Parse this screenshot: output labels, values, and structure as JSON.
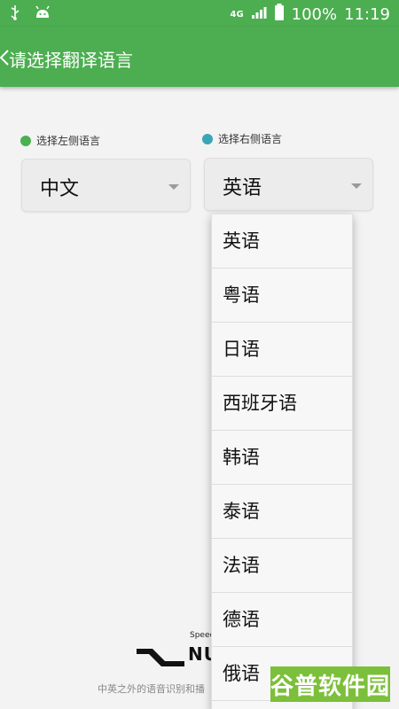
{
  "statusbar": {
    "network": "4G",
    "battery": "100%",
    "time": "11:19"
  },
  "appbar": {
    "back_icon": "chevron-left-icon",
    "title": "请选择翻译语言"
  },
  "left": {
    "label": "选择左侧语言",
    "dot_color": "#4caf50",
    "selected": "中文"
  },
  "right": {
    "label": "选择右侧语言",
    "dot_color": "#3aa6b4",
    "selected": "英语"
  },
  "dropdown": {
    "options": [
      "英语",
      "粤语",
      "日语",
      "西班牙语",
      "韩语",
      "泰语",
      "法语",
      "德语",
      "俄语"
    ]
  },
  "brand": {
    "speech": "Speech",
    "word": "NU",
    "footer": "中英之外的语音识别和播"
  },
  "watermark": {
    "text": "谷普软件园"
  },
  "colors": {
    "accent": "#4cae50",
    "watermark": "#7cbf3a"
  }
}
